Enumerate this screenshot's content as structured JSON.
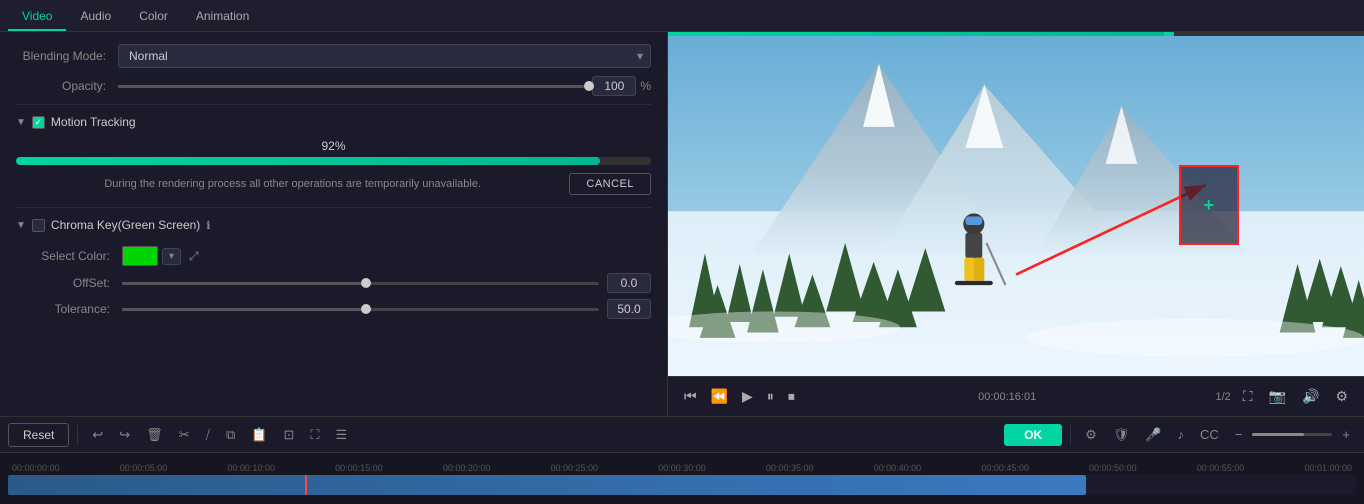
{
  "tabs": [
    {
      "label": "Video",
      "active": true
    },
    {
      "label": "Audio",
      "active": false
    },
    {
      "label": "Color",
      "active": false
    },
    {
      "label": "Animation",
      "active": false
    }
  ],
  "blending": {
    "label": "Blending Mode:",
    "value": "Normal"
  },
  "opacity": {
    "label": "Opacity:",
    "value": "100",
    "unit": "%",
    "fill_pct": 100
  },
  "motion_tracking": {
    "section_label": "Motion Tracking",
    "checked": true,
    "progress_pct": "92%",
    "progress_value": 92,
    "progress_message": "During the rendering process all other operations are temporarily unavailable.",
    "cancel_label": "CANCEL"
  },
  "chroma_key": {
    "section_label": "Chroma Key(Green Screen)",
    "checked": false,
    "select_color_label": "Select Color:",
    "offset_label": "OffSet:",
    "offset_value": "0.0",
    "tolerance_label": "Tolerance:",
    "tolerance_value": "50.0"
  },
  "video_controls": {
    "time_current": "00:00:16:01",
    "speed": "1/2",
    "time_start": "00:00:00:00"
  },
  "bottom_toolbar": {
    "reset_label": "Reset",
    "ok_label": "OK"
  },
  "timeline": {
    "markers": [
      "00:00:00:00",
      "00:00:05:00",
      "00:00:10:00",
      "00:00:15:00",
      "00:00:20:00",
      "00:00:25:00",
      "00:00:30:00",
      "00:00:35:00",
      "00:00:40:00",
      "00:00:45:00",
      "00:00:50:00",
      "00:00:55:00",
      "00:01:00:00"
    ]
  }
}
